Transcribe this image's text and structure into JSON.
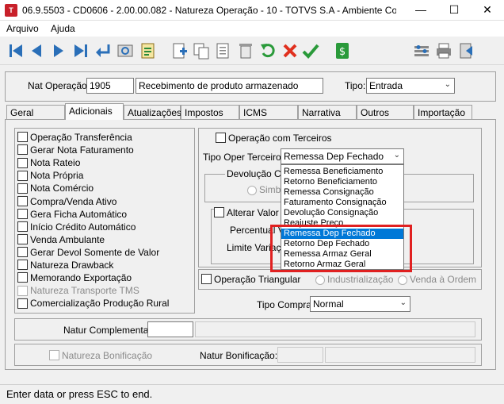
{
  "window": {
    "title": "06.9.5503 - CD0606 - 2.00.00.082 - Natureza Operação - 10 - TOTVS S.A - Ambiente Corp..."
  },
  "menu": [
    "Arquivo",
    "Ajuda"
  ],
  "header": {
    "nat_operacao_label": "Nat Operação:",
    "nat_operacao_code": "1905",
    "nat_operacao_desc": "Recebimento de produto armazenado",
    "tipo_label": "Tipo:",
    "tipo_value": "Entrada"
  },
  "tabs": [
    "Geral",
    "Adicionais",
    "Atualizações",
    "Impostos",
    "ICMS",
    "Narrativa",
    "Outros",
    "Importação"
  ],
  "left_options": [
    {
      "label": "Operação Transferência",
      "disabled": false
    },
    {
      "label": "Gerar Nota Faturamento",
      "disabled": false
    },
    {
      "label": "Nota Rateio",
      "disabled": false
    },
    {
      "label": "Nota Própria",
      "disabled": false
    },
    {
      "label": "Nota Comércio",
      "disabled": false
    },
    {
      "label": "Compra/Venda Ativo",
      "disabled": false
    },
    {
      "label": "Gera Ficha Automático",
      "disabled": false
    },
    {
      "label": "Início Crédito Automático",
      "disabled": false
    },
    {
      "label": "Venda Ambulante",
      "disabled": false
    },
    {
      "label": "Gerar Devol Somente de Valor",
      "disabled": false
    },
    {
      "label": "Natureza Drawback",
      "disabled": false
    },
    {
      "label": "Memorando Exportação",
      "disabled": false
    },
    {
      "label": "Natureza Transporte TMS",
      "disabled": true
    },
    {
      "label": "Comercialização Produção Rural",
      "disabled": false
    }
  ],
  "terceiros": {
    "checkbox_label": "Operação com Terceiros",
    "tipo_oper_label": "Tipo Oper Terceiros:",
    "tipo_oper_value": "Remessa Dep Fechado",
    "devolucao_label": "Devolução Con",
    "simbolico_label": "Simbó",
    "alterar_valor_label": "Alterar Valor I",
    "percentual_label": "Percentual Va",
    "limite_label": "Limite Variaçã",
    "options": [
      "Remessa Beneficiamento",
      "Retorno Beneficiamento",
      "Remessa Consignação",
      "Faturamento Consignação",
      "Devolução Consignação",
      "Reajuste Preço",
      "Remessa Dep Fechado",
      "Retorno Dep Fechado",
      "Remessa Armaz Geral",
      "Retorno Armaz Geral"
    ],
    "selected_option": "Remessa Dep Fechado"
  },
  "triangular": {
    "checkbox_label": "Operação Triangular",
    "industrializacao_label": "Industrialização",
    "venda_ordem_label": "Venda à Ordem"
  },
  "tipo_compra": {
    "label": "Tipo Compra:",
    "value": "Normal"
  },
  "natur_complementar": {
    "label": "Natur Complementar:",
    "value": ""
  },
  "bonificacao": {
    "checkbox_label": "Natureza Bonificação",
    "natur_label": "Natur Bonificação:"
  },
  "status": {
    "text": "Enter data or press ESC to end."
  },
  "colors": {
    "selection": "#0078d7",
    "highlight": "#e02020",
    "toolbar_blue": "#2a6fb8"
  }
}
